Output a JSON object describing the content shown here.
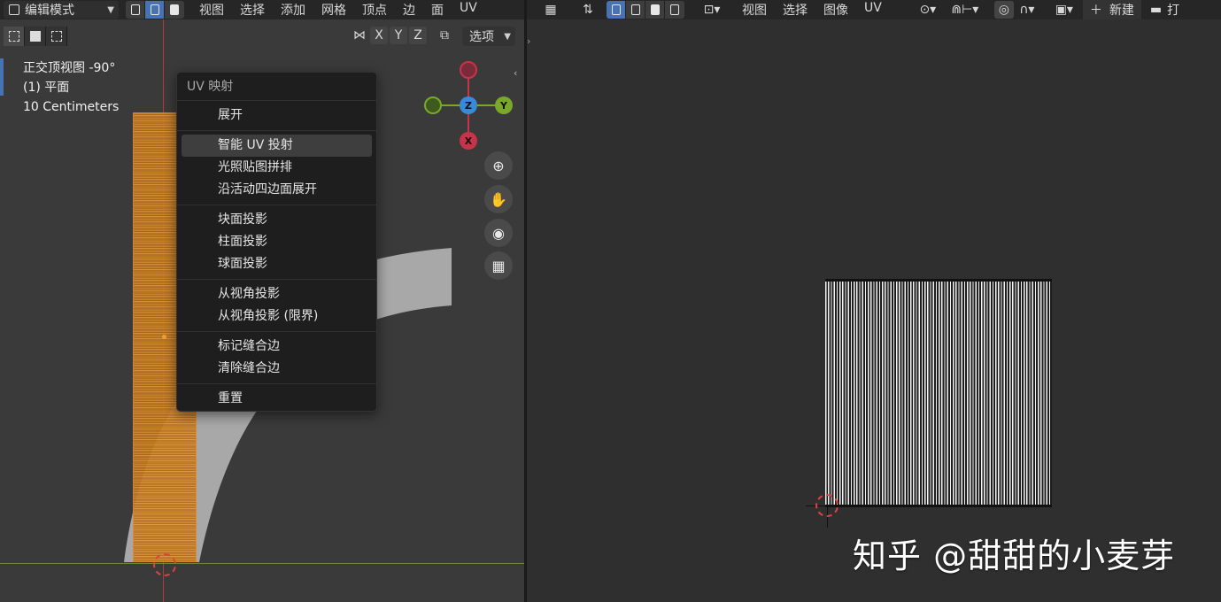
{
  "left_header": {
    "mode_label": "编辑模式",
    "menus": [
      "视图",
      "选择",
      "添加",
      "网格",
      "顶点",
      "边",
      "面",
      "UV"
    ]
  },
  "viewport_tools": {
    "axes": [
      "X",
      "Y",
      "Z"
    ],
    "options_label": "选项"
  },
  "viewport_info": {
    "view_name": "正交顶视图 -90°",
    "object_name": "(1) 平面",
    "scale": "10 Centimeters"
  },
  "gizmo": {
    "z": "Z",
    "y": "Y",
    "x": "X"
  },
  "uv_menu": {
    "title": "UV 映射",
    "groups": [
      [
        "展开"
      ],
      [
        "智能 UV 投射",
        "光照贴图拼排",
        "沿活动四边面展开"
      ],
      [
        "块面投影",
        "柱面投影",
        "球面投影"
      ],
      [
        "从视角投影",
        "从视角投影 (限界)"
      ],
      [
        "标记缝合边",
        "清除缝合边"
      ],
      [
        "重置"
      ]
    ],
    "highlighted": "智能 UV 投射"
  },
  "right_header": {
    "menus": [
      "视图",
      "选择",
      "图像",
      "UV"
    ],
    "new_label": "新建",
    "open_label": "打"
  },
  "watermark": "知乎 @甜甜的小麦芽",
  "colors": {
    "accent": "#4772b3",
    "mesh_orange": "#e08a2a",
    "axis_red": "#b33a3a",
    "gizmo_red": "#c8334a",
    "gizmo_green": "#7aa82a",
    "gizmo_blue": "#3a8ad8"
  }
}
